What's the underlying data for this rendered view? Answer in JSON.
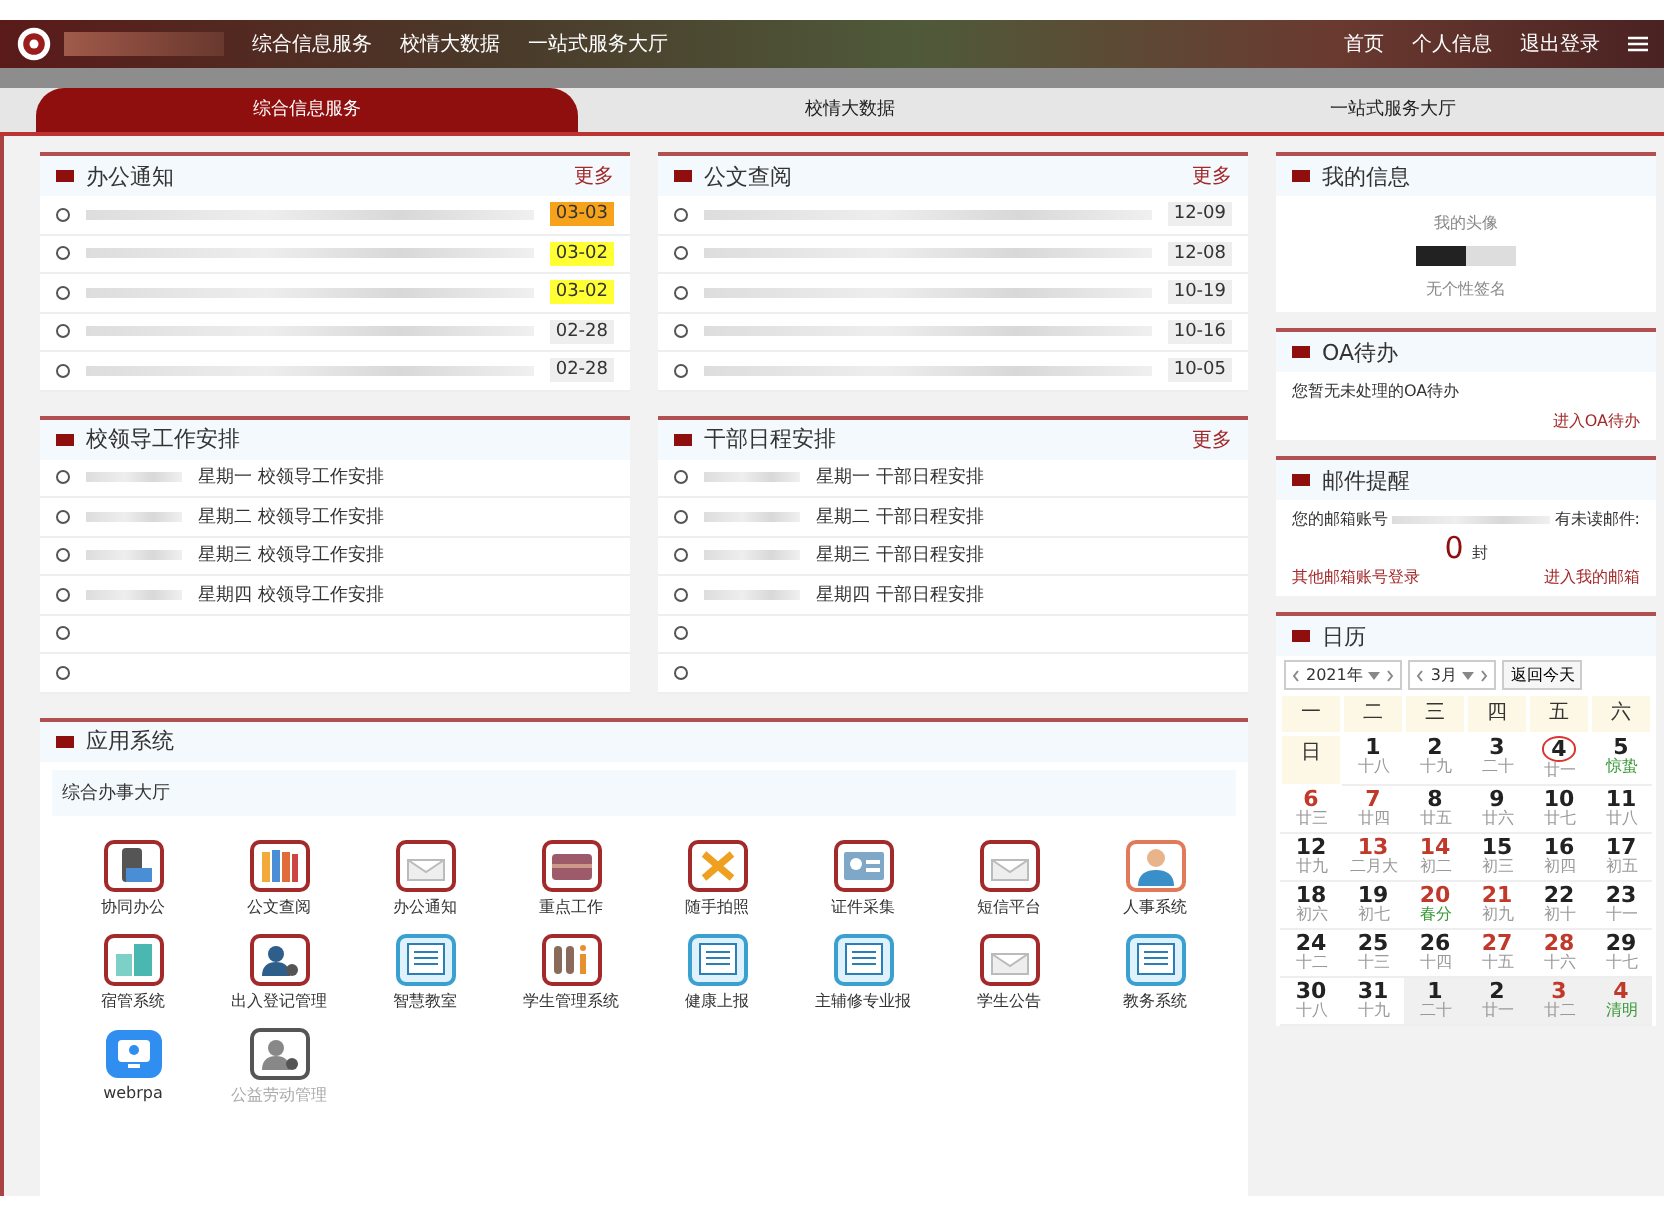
{
  "top_nav": {
    "links": [
      {
        "label": "综合信息服务"
      },
      {
        "label": "校情大数据"
      },
      {
        "label": "一站式服务大厅"
      }
    ],
    "right_links": [
      {
        "label": "首页"
      },
      {
        "label": "个人信息"
      },
      {
        "label": "退出登录"
      }
    ]
  },
  "tabs": [
    {
      "label": "综合信息服务",
      "selected": true
    },
    {
      "label": "校情大数据",
      "selected": false
    },
    {
      "label": "一站式服务大厅",
      "selected": false
    }
  ],
  "notices": {
    "title": "办公通知",
    "more": "更多",
    "rows": [
      {
        "date": "03-03",
        "color": "#f7a21b"
      },
      {
        "date": "03-02",
        "color": "#ffff33"
      },
      {
        "date": "03-02",
        "color": "#ffff33"
      },
      {
        "date": "02-28",
        "color": "#eeeeee"
      },
      {
        "date": "02-28",
        "color": "#eeeeee"
      }
    ]
  },
  "documents": {
    "title": "公文查阅",
    "more": "更多",
    "rows": [
      {
        "date": "12-09"
      },
      {
        "date": "12-08"
      },
      {
        "date": "10-19"
      },
      {
        "date": "10-16"
      },
      {
        "date": "10-05"
      }
    ]
  },
  "leader_schedule": {
    "title": "校领导工作安排",
    "rows": [
      {
        "text": "星期一 校领导工作安排"
      },
      {
        "text": "星期二 校领导工作安排"
      },
      {
        "text": "星期三 校领导工作安排"
      },
      {
        "text": "星期四 校领导工作安排"
      },
      {
        "text": ""
      },
      {
        "text": ""
      }
    ]
  },
  "cadre_schedule": {
    "title": "干部日程安排",
    "more": "更多",
    "rows": [
      {
        "text": "星期一 干部日程安排"
      },
      {
        "text": "星期二 干部日程安排"
      },
      {
        "text": "星期三 干部日程安排"
      },
      {
        "text": "星期四 干部日程安排"
      },
      {
        "text": ""
      },
      {
        "text": ""
      }
    ]
  },
  "apps": {
    "title": "应用系统",
    "subtitle": "综合办事大厅",
    "items": [
      {
        "label": "协同办公",
        "kind": "phone",
        "disabled": false
      },
      {
        "label": "公文查阅",
        "kind": "books",
        "disabled": false
      },
      {
        "label": "办公通知",
        "kind": "mail",
        "disabled": false
      },
      {
        "label": "重点工作",
        "kind": "case",
        "disabled": false
      },
      {
        "label": "随手拍照",
        "kind": "tools",
        "disabled": false
      },
      {
        "label": "证件采集",
        "kind": "card",
        "disabled": false
      },
      {
        "label": "短信平台",
        "kind": "mail",
        "disabled": false
      },
      {
        "label": "人事系统",
        "kind": "person",
        "disabled": false
      },
      {
        "label": "宿管系统",
        "kind": "building",
        "disabled": false
      },
      {
        "label": "出入登记管理",
        "kind": "user",
        "disabled": false
      },
      {
        "label": "智慧教室",
        "kind": "list",
        "disabled": false
      },
      {
        "label": "学生管理系统",
        "kind": "chart",
        "disabled": false
      },
      {
        "label": "健康上报",
        "kind": "list",
        "disabled": false
      },
      {
        "label": "主辅修专业报",
        "kind": "list",
        "disabled": false
      },
      {
        "label": "学生公告",
        "kind": "mail",
        "disabled": false
      },
      {
        "label": "教务系统",
        "kind": "list",
        "disabled": false
      },
      {
        "label": "webrpa",
        "kind": "screen",
        "disabled": false
      },
      {
        "label": "公益劳动管理",
        "kind": "user",
        "disabled": true
      }
    ]
  },
  "my_info": {
    "title": "我的信息",
    "avatar_alt": "我的头像",
    "signature": "无个性签名"
  },
  "oa": {
    "title": "OA待办",
    "message": "您暂无未处理的OA待办",
    "link": "进入OA待办"
  },
  "mail": {
    "title": "邮件提醒",
    "prefix": "您的邮箱账号",
    "suffix": "有未读邮件:",
    "count": "0",
    "unit": "封",
    "other_login": "其他邮箱账号登录",
    "enter": "进入我的邮箱"
  },
  "calendar": {
    "title": "日历",
    "year": "2021年",
    "month": "3月",
    "today_button": "返回今天",
    "weekdays": [
      "一",
      "二",
      "三",
      "四",
      "五",
      "六",
      "日"
    ],
    "days": [
      {
        "day": "1",
        "lunar": "十八",
        "red": false,
        "term": false,
        "other": false,
        "today": false
      },
      {
        "day": "2",
        "lunar": "十九",
        "red": false,
        "term": false,
        "other": false,
        "today": false
      },
      {
        "day": "3",
        "lunar": "二十",
        "red": false,
        "term": false,
        "other": false,
        "today": false
      },
      {
        "day": "4",
        "lunar": "廿一",
        "red": false,
        "term": false,
        "other": false,
        "today": true
      },
      {
        "day": "5",
        "lunar": "惊蛰",
        "red": false,
        "term": true,
        "other": false,
        "today": false
      },
      {
        "day": "6",
        "lunar": "廿三",
        "red": true,
        "term": false,
        "other": false,
        "today": false
      },
      {
        "day": "7",
        "lunar": "廿四",
        "red": true,
        "term": false,
        "other": false,
        "today": false
      },
      {
        "day": "8",
        "lunar": "廿五",
        "red": false,
        "term": false,
        "other": false,
        "today": false
      },
      {
        "day": "9",
        "lunar": "廿六",
        "red": false,
        "term": false,
        "other": false,
        "today": false
      },
      {
        "day": "10",
        "lunar": "廿七",
        "red": false,
        "term": false,
        "other": false,
        "today": false
      },
      {
        "day": "11",
        "lunar": "廿八",
        "red": false,
        "term": false,
        "other": false,
        "today": false
      },
      {
        "day": "12",
        "lunar": "廿九",
        "red": false,
        "term": false,
        "other": false,
        "today": false
      },
      {
        "day": "13",
        "lunar": "二月大",
        "red": true,
        "term": false,
        "other": false,
        "today": false
      },
      {
        "day": "14",
        "lunar": "初二",
        "red": true,
        "term": false,
        "other": false,
        "today": false
      },
      {
        "day": "15",
        "lunar": "初三",
        "red": false,
        "term": false,
        "other": false,
        "today": false
      },
      {
        "day": "16",
        "lunar": "初四",
        "red": false,
        "term": false,
        "other": false,
        "today": false
      },
      {
        "day": "17",
        "lunar": "初五",
        "red": false,
        "term": false,
        "other": false,
        "today": false
      },
      {
        "day": "18",
        "lunar": "初六",
        "red": false,
        "term": false,
        "other": false,
        "today": false
      },
      {
        "day": "19",
        "lunar": "初七",
        "red": false,
        "term": false,
        "other": false,
        "today": false
      },
      {
        "day": "20",
        "lunar": "春分",
        "red": true,
        "term": true,
        "other": false,
        "today": false
      },
      {
        "day": "21",
        "lunar": "初九",
        "red": true,
        "term": false,
        "other": false,
        "today": false
      },
      {
        "day": "22",
        "lunar": "初十",
        "red": false,
        "term": false,
        "other": false,
        "today": false
      },
      {
        "day": "23",
        "lunar": "十一",
        "red": false,
        "term": false,
        "other": false,
        "today": false
      },
      {
        "day": "24",
        "lunar": "十二",
        "red": false,
        "term": false,
        "other": false,
        "today": false
      },
      {
        "day": "25",
        "lunar": "十三",
        "red": false,
        "term": false,
        "other": false,
        "today": false
      },
      {
        "day": "26",
        "lunar": "十四",
        "red": false,
        "term": false,
        "other": false,
        "today": false
      },
      {
        "day": "27",
        "lunar": "十五",
        "red": true,
        "term": false,
        "other": false,
        "today": false
      },
      {
        "day": "28",
        "lunar": "十六",
        "red": true,
        "term": false,
        "other": false,
        "today": false
      },
      {
        "day": "29",
        "lunar": "十七",
        "red": false,
        "term": false,
        "other": false,
        "today": false
      },
      {
        "day": "30",
        "lunar": "十八",
        "red": false,
        "term": false,
        "other": false,
        "today": false
      },
      {
        "day": "31",
        "lunar": "十九",
        "red": false,
        "term": false,
        "other": false,
        "today": false
      },
      {
        "day": "1",
        "lunar": "二十",
        "red": false,
        "term": false,
        "other": true,
        "today": false
      },
      {
        "day": "2",
        "lunar": "廿一",
        "red": false,
        "term": false,
        "other": true,
        "today": false
      },
      {
        "day": "3",
        "lunar": "廿二",
        "red": true,
        "term": false,
        "other": true,
        "today": false
      },
      {
        "day": "4",
        "lunar": "清明",
        "red": true,
        "term": true,
        "other": true,
        "today": false
      }
    ]
  }
}
